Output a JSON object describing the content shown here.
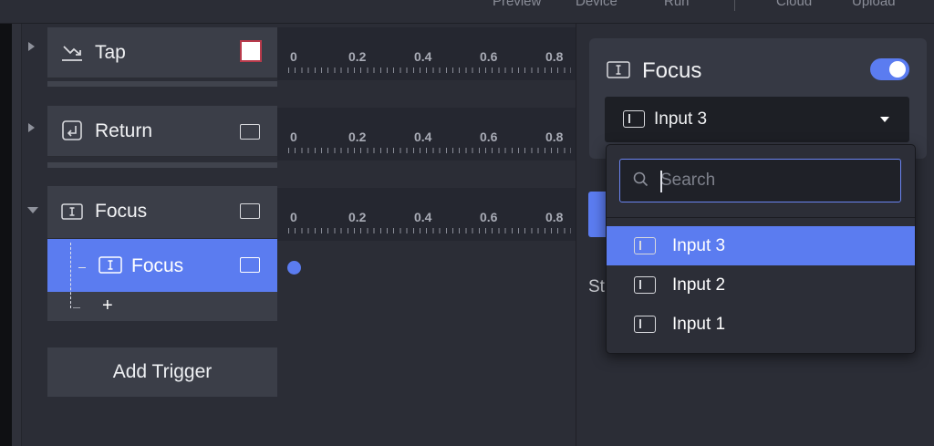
{
  "topbar": {
    "items": [
      "Preview",
      "Device",
      "Run",
      "Cloud",
      "Upload"
    ]
  },
  "triggers": [
    {
      "label": "Tap",
      "icon": "tap-gesture-icon",
      "expanded": false
    },
    {
      "label": "Return",
      "icon": "return-key-icon",
      "expanded": false
    },
    {
      "label": "Focus",
      "icon": "text-cursor-icon",
      "expanded": true,
      "children": [
        {
          "label": "Focus",
          "selected": true
        }
      ]
    }
  ],
  "add_child_label": "+",
  "add_trigger_label": "Add Trigger",
  "ruler_ticks": [
    "0",
    "0.2",
    "0.4",
    "0.6",
    "0.8"
  ],
  "panel": {
    "title": "Focus",
    "enabled": true,
    "selected_input": "Input 3",
    "partial_label": "St"
  },
  "dropdown": {
    "search_placeholder": "Search",
    "options": [
      {
        "label": "Input 3",
        "selected": true
      },
      {
        "label": "Input 2",
        "selected": false
      },
      {
        "label": "Input 1",
        "selected": false
      }
    ]
  },
  "colors": {
    "accent": "#5b7cf0",
    "panel_bg": "#2b2d36",
    "row_bg": "#3b3e48"
  }
}
